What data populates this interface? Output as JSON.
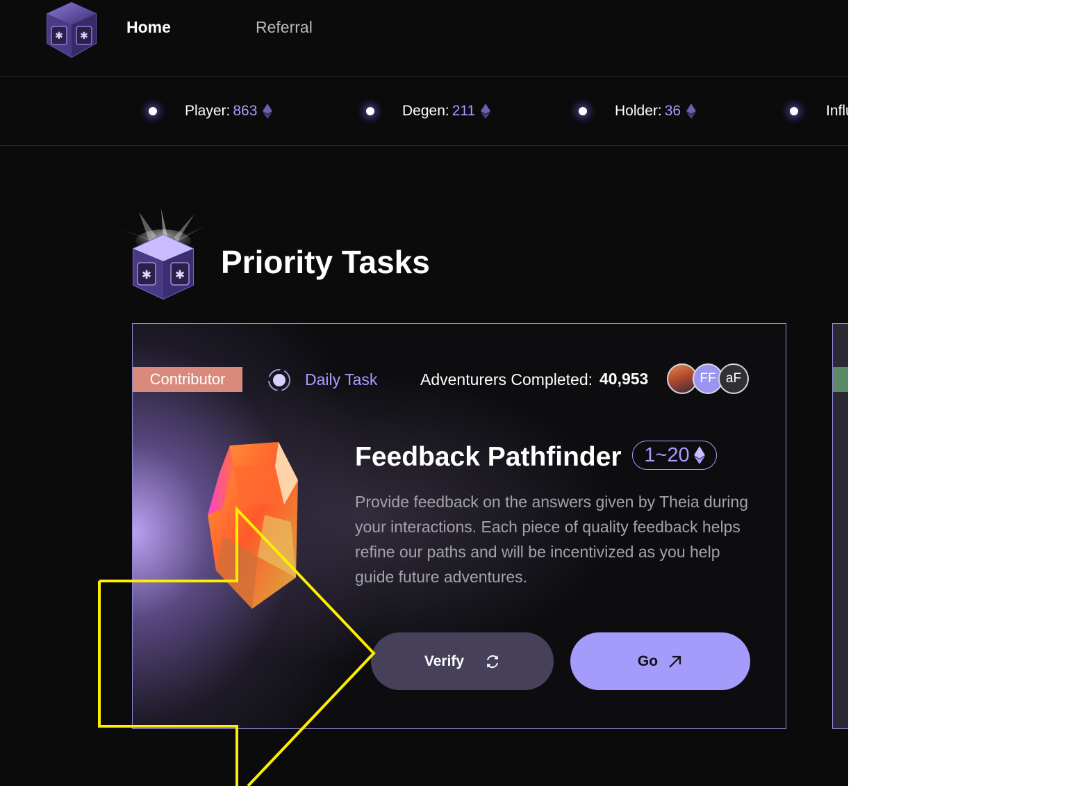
{
  "nav": {
    "home_label": "Home",
    "referral_label": "Referral"
  },
  "stats": [
    {
      "label": "Player:",
      "value": "863"
    },
    {
      "label": "Degen:",
      "value": "211"
    },
    {
      "label": "Holder:",
      "value": "36"
    },
    {
      "label": "Influ",
      "value": ""
    }
  ],
  "section": {
    "title": "Priority Tasks"
  },
  "task": {
    "role_badge": "Contributor",
    "frequency_label": "Daily Task",
    "completed_label": "Adventurers Completed:",
    "completed_count": "40,953",
    "avatars": [
      "",
      "FF",
      "aF"
    ],
    "title": "Feedback Pathfinder",
    "reward": "1~20",
    "description": "Provide feedback on the answers given by Theia during your interactions. Each piece of quality feedback helps refine our paths and will be incentivized as you help guide future adventures.",
    "verify_label": "Verify",
    "go_label": "Go"
  },
  "colors": {
    "background": "#0b0b0c",
    "accent": "#a89cff",
    "contributor_badge": "#d98a7d",
    "go_button": "#a49bfb",
    "verify_button": "#47405a",
    "annotation": "#ffee00"
  },
  "icons": {
    "logo": "cube-logo-icon",
    "currency": "ethereum-icon",
    "daily": "radio-target-icon",
    "verify": "refresh-icon",
    "go": "arrow-up-right-icon"
  }
}
